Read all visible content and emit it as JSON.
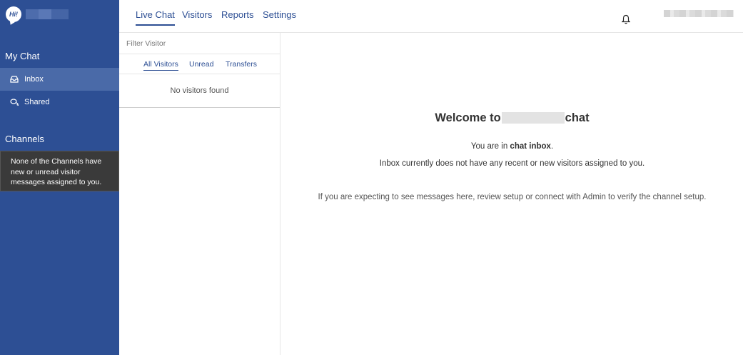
{
  "sidebar": {
    "logo_text": "Hi!",
    "my_chat_title": "My Chat",
    "items": [
      {
        "label": "Inbox",
        "icon": "inbox-icon",
        "active": true
      },
      {
        "label": "Shared",
        "icon": "chat-bubbles-icon",
        "active": false
      }
    ],
    "channels_title": "Channels",
    "channels_note": "None of the Channels have new or unread visitor messages assigned to you."
  },
  "topbar": {
    "tabs": [
      {
        "label": "Live Chat",
        "active": true
      },
      {
        "label": "Visitors",
        "active": false
      },
      {
        "label": "Reports",
        "active": false
      },
      {
        "label": "Settings",
        "active": false
      }
    ],
    "notification_icon": "bell-icon"
  },
  "visitors": {
    "filter_placeholder": "Filter Visitor",
    "tabs": [
      {
        "label": "All Visitors",
        "active": true
      },
      {
        "label": "Unread",
        "active": false
      },
      {
        "label": "Transfers",
        "active": false
      }
    ],
    "empty_text": "No visitors found"
  },
  "main": {
    "welcome_prefix": "Welcome to",
    "welcome_suffix": "chat",
    "inbox_prefix": "You are in ",
    "inbox_bold": "chat inbox",
    "inbox_suffix": ".",
    "inbox_line": "Inbox currently does not have any recent or new visitors assigned to you.",
    "expect_line": "If you are expecting to see messages here, review setup or connect with Admin to verify the channel setup."
  },
  "colors": {
    "sidebar_bg": "#2d4f94",
    "sidebar_active": "#4a6aa8",
    "accent": "#2d4f94",
    "channels_note_bg": "#3a3a3a"
  }
}
